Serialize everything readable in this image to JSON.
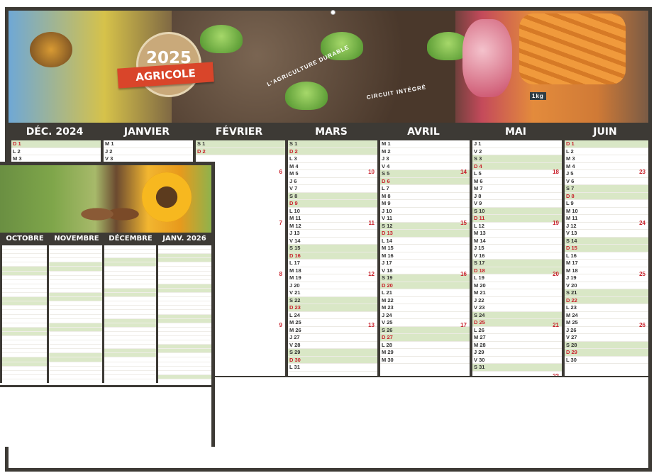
{
  "calendar": {
    "year": "2025",
    "title": "AGRICOLE",
    "main_months": [
      "DÉC. 2024",
      "JANVIER",
      "FÉVRIER",
      "MARS",
      "AVRIL",
      "MAI",
      "JUIN"
    ],
    "mini_months": [
      "OCTOBRE",
      "NOVEMBRE",
      "DÉCEMBRE",
      "JANV. 2026"
    ],
    "banner_texts": [
      "L'AGRICULTURE DURABLE",
      "CIRCUIT INTÉGRÉ"
    ],
    "price_tag": "1kg"
  },
  "columns": {
    "dec": {
      "days": [
        "D 1",
        "L 2",
        "M 3",
        "M 4"
      ]
    },
    "jan": {
      "days": [
        "M 1",
        "J 2",
        "V 3",
        "S 4"
      ]
    },
    "mars": {
      "days": [
        "S 1",
        "D 2",
        "L 3",
        "M 4",
        "M 5",
        "J 6",
        "V 7",
        "S 8",
        "D 9",
        "L 10",
        "M 11",
        "M 12",
        "J 13",
        "V 14",
        "S 15",
        "D 16",
        "L 17",
        "M 18",
        "M 19",
        "J 20",
        "V 21",
        "S 22",
        "D 23",
        "L 24",
        "M 25",
        "M 26",
        "J 27",
        "V 28",
        "S 29",
        "D 30",
        "L 31"
      ],
      "weeks": [
        "10",
        "11",
        "12",
        "13"
      ]
    },
    "avril": {
      "days": [
        "M 1",
        "M 2",
        "J 3",
        "V 4",
        "S 5",
        "D 6",
        "L 7",
        "M 8",
        "M 9",
        "J 10",
        "V 11",
        "S 12",
        "D 13",
        "L 14",
        "M 15",
        "M 16",
        "J 17",
        "V 18",
        "S 19",
        "D 20",
        "L 21",
        "M 22",
        "M 23",
        "J 24",
        "V 25",
        "S 26",
        "D 27",
        "L 28",
        "M 29",
        "M 30"
      ],
      "weeks": [
        "14",
        "15",
        "16",
        "17"
      ]
    },
    "mai": {
      "days": [
        "J 1",
        "V 2",
        "S 3",
        "D 4",
        "L 5",
        "M 6",
        "M 7",
        "J 8",
        "V 9",
        "S 10",
        "D 11",
        "L 12",
        "M 13",
        "M 14",
        "J 15",
        "V 16",
        "S 17",
        "D 18",
        "L 19",
        "M 20",
        "M 21",
        "J 22",
        "V 23",
        "S 24",
        "D 25",
        "L 26",
        "M 27",
        "M 28",
        "J 29",
        "V 30",
        "S 31"
      ],
      "weeks": [
        "18",
        "19",
        "20",
        "21",
        "22"
      ]
    },
    "juin": {
      "days": [
        "D 1",
        "L 2",
        "M 3",
        "M 4",
        "J 5",
        "V 6",
        "S 7",
        "D 8",
        "L 9",
        "M 10",
        "M 11",
        "J 12",
        "V 13",
        "S 14",
        "D 15",
        "L 16",
        "M 17",
        "M 18",
        "J 19",
        "V 20",
        "S 21",
        "D 22",
        "L 23",
        "M 24",
        "M 25",
        "J 26",
        "V 27",
        "S 28",
        "D 29",
        "L 30"
      ],
      "weeks": [
        "23",
        "24",
        "25",
        "26"
      ]
    },
    "fev": {
      "days": [
        "S 1",
        "D 2"
      ],
      "weeks": [
        "6",
        "7",
        "8",
        "9"
      ]
    }
  }
}
